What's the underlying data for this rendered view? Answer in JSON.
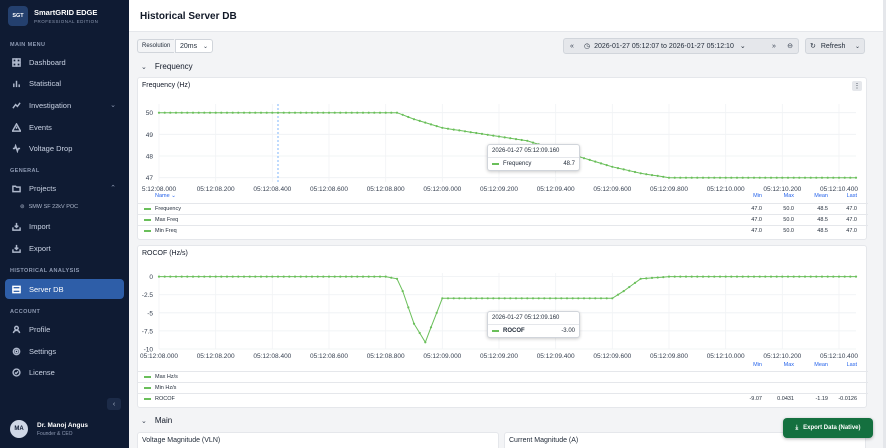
{
  "app": {
    "logo": "SGT",
    "name": "SmartGRID EDGE",
    "edition": "PROFESSIONAL EDITION"
  },
  "sidebar": {
    "main_menu_label": "MAIN MENU",
    "general_label": "GENERAL",
    "historical_label": "HISTORICAL ANALYSIS",
    "account_label": "ACCOUNT",
    "items": {
      "dashboard": "Dashboard",
      "statistical": "Statistical",
      "investigation": "Investigation",
      "events": "Events",
      "voltage_drop": "Voltage Drop",
      "projects": "Projects",
      "project_sub": "SMW SF 22kV POC",
      "import": "Import",
      "export": "Export",
      "server_db": "Server DB",
      "profile": "Profile",
      "settings": "Settings",
      "license": "License"
    },
    "user": {
      "initials": "MA",
      "name": "Dr. Manoj Angus",
      "role": "Founder & CEO"
    }
  },
  "header": {
    "title": "Historical Server DB"
  },
  "toolbar": {
    "resolution_label": "Resolution",
    "resolution_value": "20ms",
    "date_range": "2026-01-27 05:12:07 to 2026-01-27 05:12:10",
    "refresh_label": "Refresh"
  },
  "sections": {
    "frequency": "Frequency",
    "main": "Main"
  },
  "frequency_chart": {
    "title": "Frequency (Hz)",
    "tooltip_time": "2026-01-27 05:12:09.160",
    "tooltip_series": "Frequency",
    "tooltip_value": "48.7",
    "legend_header": "Name",
    "stat_headers": [
      "Min",
      "Max",
      "Mean",
      "Last"
    ],
    "legend": [
      {
        "name": "Frequency",
        "stats": [
          "47.0",
          "50.0",
          "48.5",
          "47.0"
        ]
      },
      {
        "name": "Max Freq",
        "stats": [
          "47.0",
          "50.0",
          "48.5",
          "47.0"
        ]
      },
      {
        "name": "Min Freq",
        "stats": [
          "47.0",
          "50.0",
          "48.5",
          "47.0"
        ]
      }
    ]
  },
  "rocof_chart": {
    "title": "ROCOF (Hz/s)",
    "tooltip_time": "2026-01-27 05:12:09.160",
    "tooltip_series": "ROCOF",
    "tooltip_value": "-3.00",
    "legend_header": "Name",
    "stat_headers": [
      "Min",
      "Max",
      "Mean",
      "Last"
    ],
    "legend": [
      {
        "name": "Max Hz/s",
        "stats": [
          "",
          "",
          "",
          ""
        ]
      },
      {
        "name": "Min Hz/s",
        "stats": [
          "",
          "",
          "",
          ""
        ]
      },
      {
        "name": "ROCOF",
        "stats": [
          "-9.07",
          "0.0431",
          "-1.19",
          "-0.0126"
        ]
      }
    ]
  },
  "bottom": {
    "voltage_title": "Voltage Magnitude (VLN)",
    "current_title": "Current Magnitude (A)",
    "export_label": "Export Data (Native)"
  },
  "colors": {
    "series": "#6abf5a",
    "accent": "#2e5ea8",
    "export": "#14703f"
  },
  "chart_data": [
    {
      "type": "line",
      "title": "Frequency (Hz)",
      "xlabel": "",
      "ylabel": "",
      "x_ticks": [
        "5:12:08.000",
        "05:12:08.200",
        "05:12:08.400",
        "05:12:08.600",
        "05:12:08.800",
        "05:12:09.000",
        "05:12:09.200",
        "05:12:09.400",
        "05:12:09.600",
        "05:12:09.800",
        "05:12:10.000",
        "05:12:10.200",
        "05:12:10.400"
      ],
      "y_ticks": [
        47,
        48,
        49,
        50
      ],
      "ylim": [
        46.8,
        50.4
      ],
      "xlim": [
        0,
        2.46
      ],
      "series": [
        {
          "name": "Frequency",
          "x": [
            0,
            0.1,
            0.2,
            0.3,
            0.4,
            0.5,
            0.6,
            0.7,
            0.8,
            0.84,
            0.9,
            1.0,
            1.1,
            1.2,
            1.3,
            1.4,
            1.5,
            1.6,
            1.7,
            1.8,
            1.9,
            2.0,
            2.1,
            2.2,
            2.3,
            2.46
          ],
          "y": [
            50.0,
            50.0,
            50.0,
            50.0,
            50.0,
            50.0,
            50.0,
            50.0,
            50.0,
            50.0,
            49.7,
            49.3,
            49.1,
            48.9,
            48.7,
            48.3,
            47.9,
            47.5,
            47.2,
            47.0,
            47.0,
            47.0,
            47.0,
            47.0,
            47.0,
            47.0
          ]
        }
      ]
    },
    {
      "type": "line",
      "title": "ROCOF (Hz/s)",
      "xlabel": "",
      "ylabel": "",
      "x_ticks": [
        "05:12:08.000",
        "05:12:08.200",
        "05:12:08.400",
        "05:12:08.600",
        "05:12:08.800",
        "05:12:09.000",
        "05:12:09.200",
        "05:12:09.400",
        "05:12:09.600",
        "05:12:09.800",
        "05:12:10.000",
        "05:12:10.200",
        "05:12:10.400"
      ],
      "y_ticks": [
        0,
        -2.5,
        -5,
        -7.5,
        -10
      ],
      "ylim": [
        -10,
        0.5
      ],
      "xlim": [
        0,
        2.46
      ],
      "series": [
        {
          "name": "ROCOF",
          "x": [
            0,
            0.2,
            0.4,
            0.6,
            0.8,
            0.84,
            0.86,
            0.9,
            0.94,
            0.96,
            1.0,
            1.1,
            1.2,
            1.3,
            1.4,
            1.5,
            1.6,
            1.64,
            1.7,
            1.8,
            2.0,
            2.2,
            2.46
          ],
          "y": [
            0,
            0,
            0,
            0,
            0,
            -0.3,
            -2.0,
            -6.5,
            -9.07,
            -7.0,
            -3.0,
            -3.0,
            -3.0,
            -3.0,
            -3.0,
            -3.0,
            -3.0,
            -2.0,
            -0.3,
            0,
            0,
            0,
            0
          ]
        }
      ]
    }
  ]
}
